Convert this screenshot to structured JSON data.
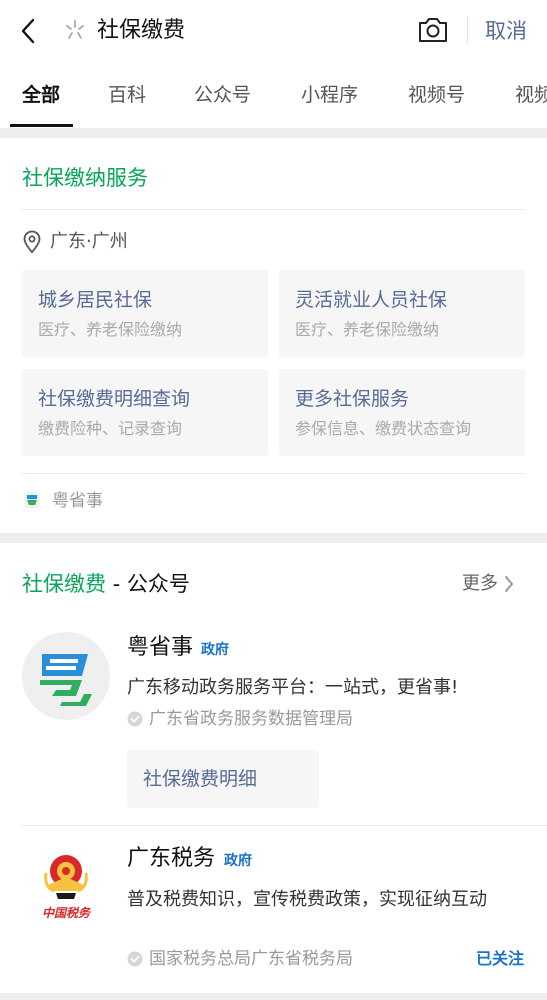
{
  "search": {
    "query": "社保缴费",
    "cancel_label": "取消"
  },
  "tabs": [
    {
      "label": "全部",
      "active": true
    },
    {
      "label": "百科"
    },
    {
      "label": "公众号"
    },
    {
      "label": "小程序"
    },
    {
      "label": "视频号"
    },
    {
      "label": "视频"
    }
  ],
  "service_card": {
    "title": "社保缴纳服务",
    "location": "广东·广州",
    "tiles": [
      {
        "title": "城乡居民社保",
        "subtitle": "医疗、养老保险缴纳"
      },
      {
        "title": "灵活就业人员社保",
        "subtitle": "医疗、养老保险缴纳"
      },
      {
        "title": "社保缴费明细查询",
        "subtitle": "缴费险种、记录查询"
      },
      {
        "title": "更多社保服务",
        "subtitle": "参保信息、缴费状态查询"
      }
    ],
    "source": "粤省事"
  },
  "accounts_section": {
    "heading_keyword": "社保缴费",
    "heading_suffix": " - 公众号",
    "more_label": "更多",
    "accounts": [
      {
        "name": "粤省事",
        "badge": "政府",
        "description": "广东移动政务服务平台：一站式，更省事!",
        "verified_by": "广东省政务服务数据管理局",
        "action_label": "社保缴费明细"
      },
      {
        "name": "广东税务",
        "badge": "政府",
        "description": "普及税费知识，宣传税费政策，实现征纳互动",
        "verified_by": "国家税务总局广东省税务局",
        "status": "已关注",
        "logo_caption": "中国税务"
      }
    ]
  },
  "colors": {
    "brand_green": "#07a65b",
    "link_blue": "#576b95",
    "badge_blue": "#1a73c8"
  }
}
